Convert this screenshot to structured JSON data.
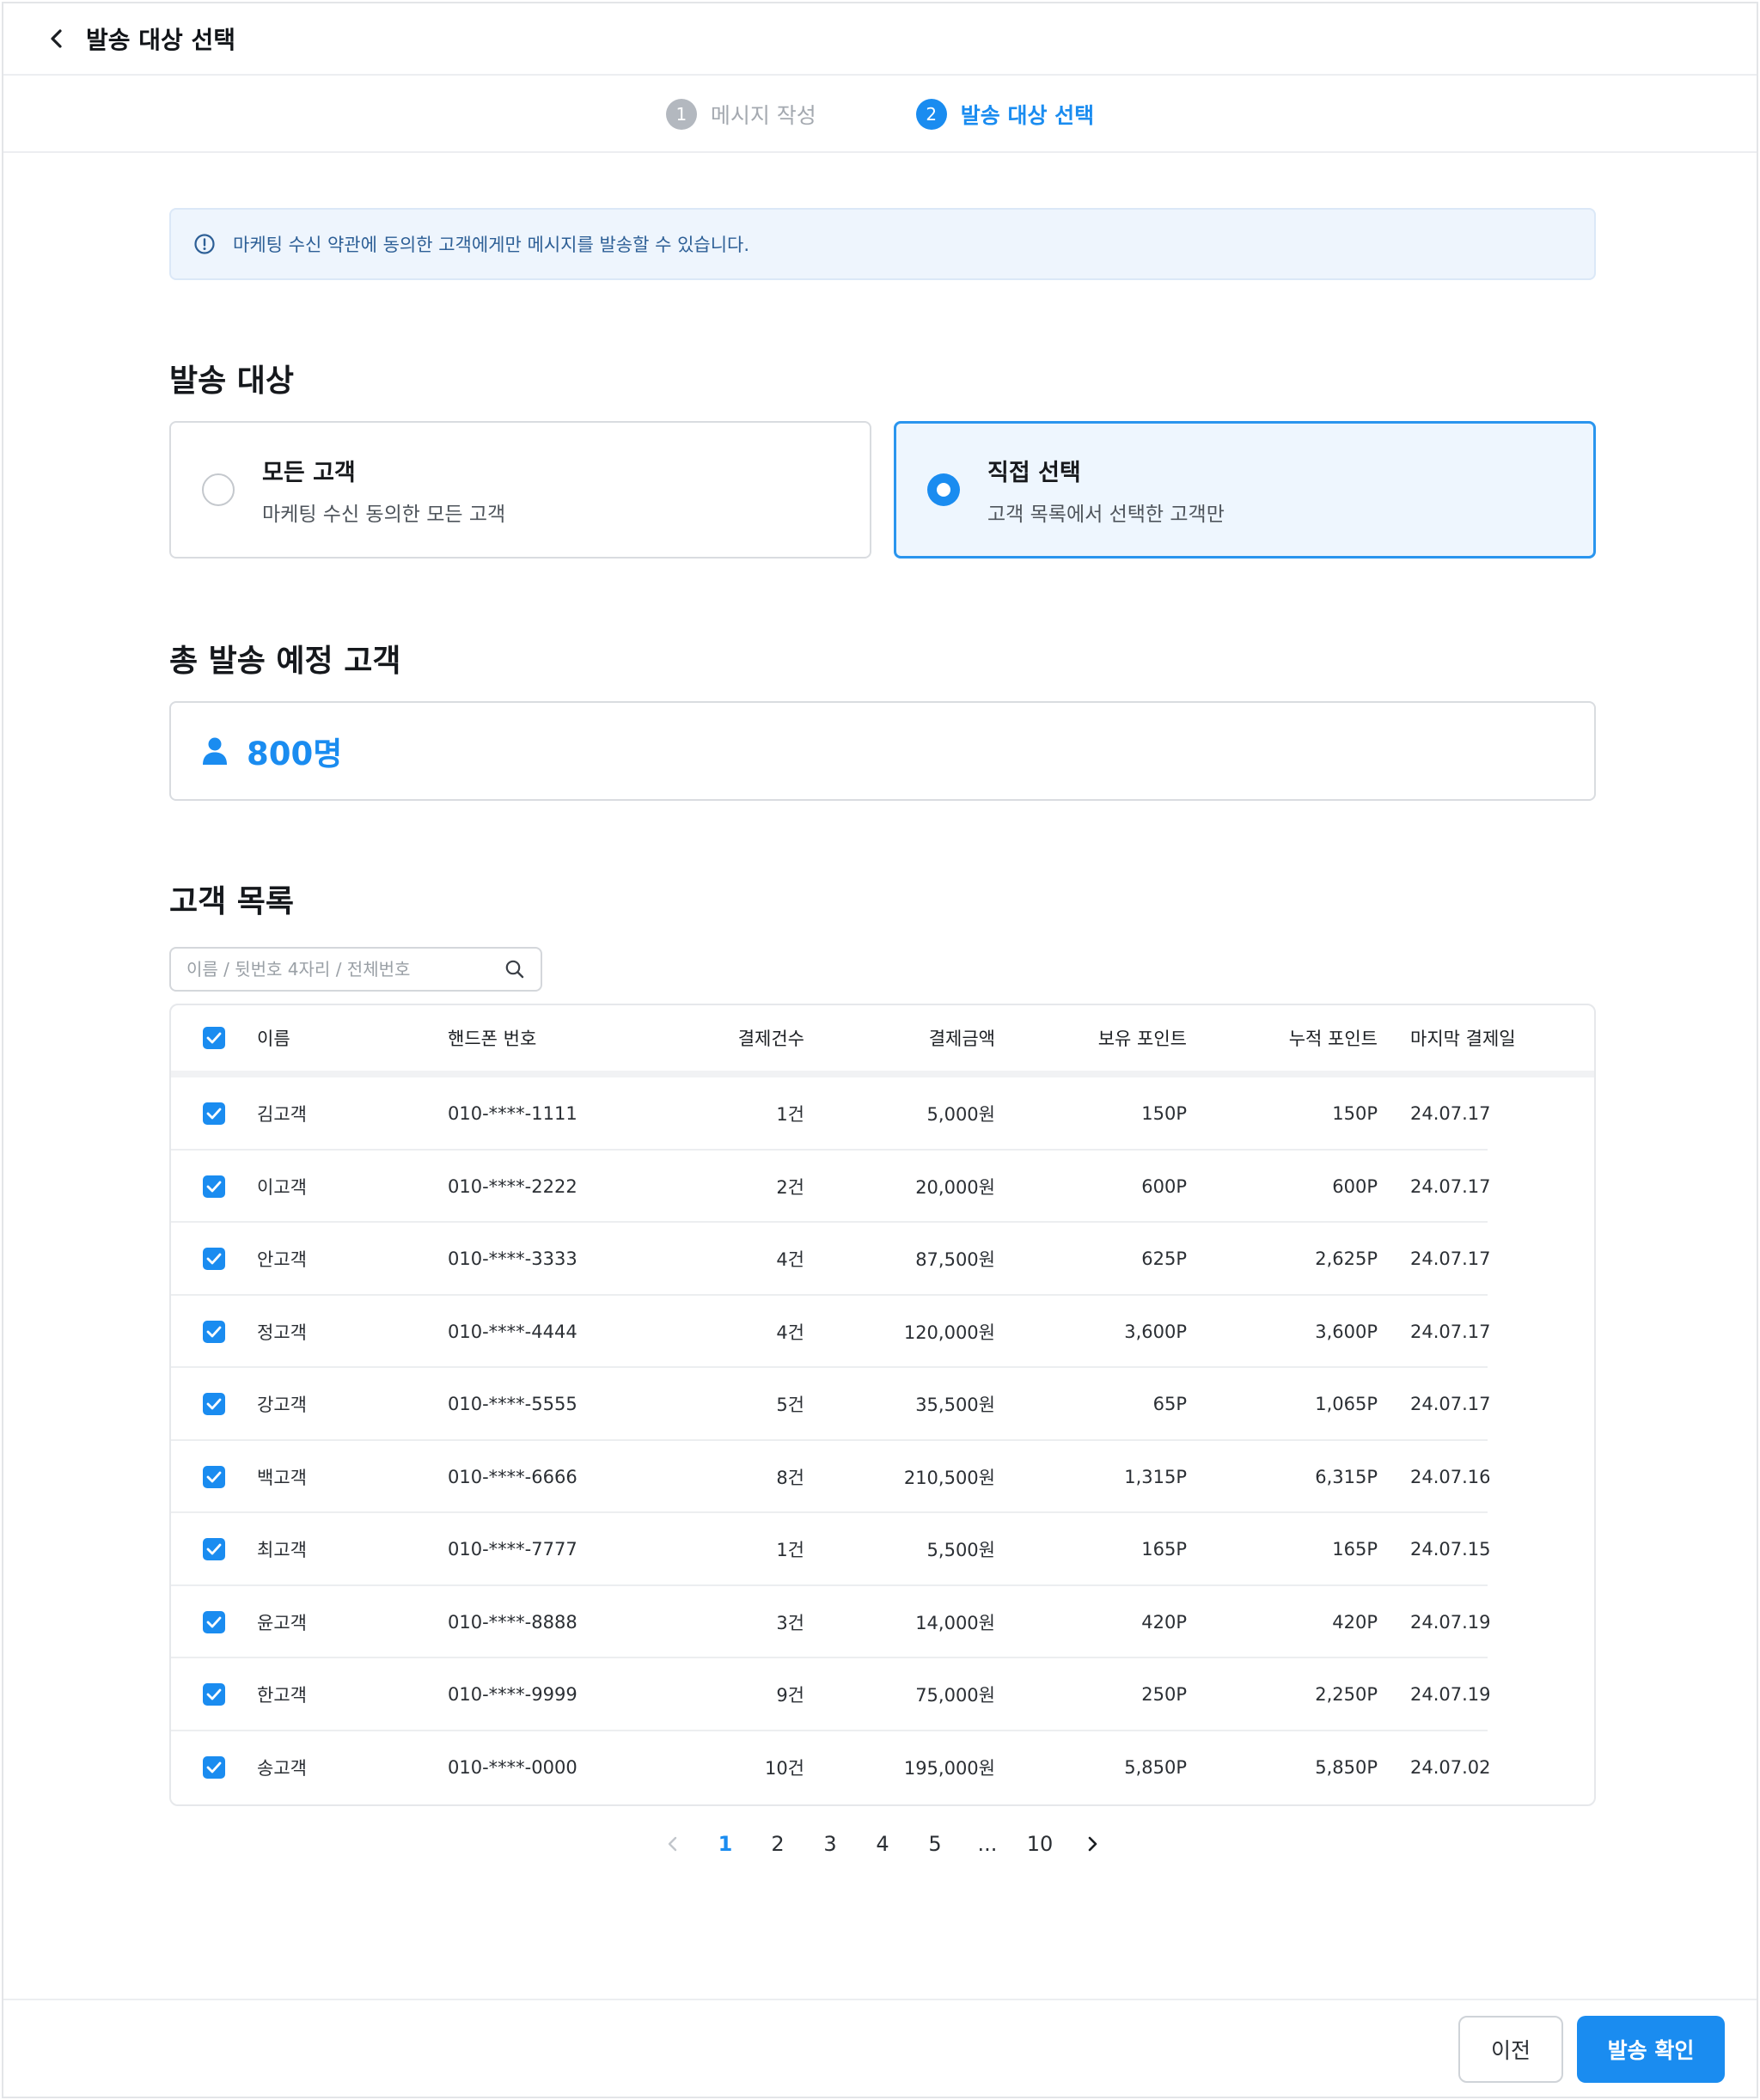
{
  "header": {
    "title": "발송 대상 선택",
    "back_icon": "chevron-left-icon"
  },
  "stepper": {
    "steps": [
      {
        "num": "1",
        "label": "메시지 작성",
        "state": "inactive"
      },
      {
        "num": "2",
        "label": "발송 대상 선택",
        "state": "active"
      }
    ]
  },
  "notice": {
    "icon": "info-circle-icon",
    "text": "마케팅 수신 약관에 동의한 고객에게만 메시지를 발송할 수 있습니다."
  },
  "target": {
    "title": "발송 대상",
    "options": [
      {
        "title": "모든 고객",
        "desc": "마케팅 수신 동의한 모든 고객",
        "selected": false
      },
      {
        "title": "직접 선택",
        "desc": "고객 목록에서 선택한 고객만",
        "selected": true
      }
    ]
  },
  "total": {
    "title": "총 발송 예정 고객",
    "value": "800명",
    "icon": "person-icon"
  },
  "customers": {
    "title": "고객 목록",
    "search_placeholder": "이름 / 뒷번호 4자리 / 전체번호",
    "columns": [
      "이름",
      "핸드폰 번호",
      "결제건수",
      "결제금액",
      "보유 포인트",
      "누적 포인트",
      "마지막 결제일"
    ],
    "rows": [
      {
        "name": "김고객",
        "phone": "010-****-1111",
        "count": "1건",
        "amount": "5,000원",
        "hold": "150P",
        "acc": "150P",
        "date": "24.07.17"
      },
      {
        "name": "이고객",
        "phone": "010-****-2222",
        "count": "2건",
        "amount": "20,000원",
        "hold": "600P",
        "acc": "600P",
        "date": "24.07.17"
      },
      {
        "name": "안고객",
        "phone": "010-****-3333",
        "count": "4건",
        "amount": "87,500원",
        "hold": "625P",
        "acc": "2,625P",
        "date": "24.07.17"
      },
      {
        "name": "정고객",
        "phone": "010-****-4444",
        "count": "4건",
        "amount": "120,000원",
        "hold": "3,600P",
        "acc": "3,600P",
        "date": "24.07.17"
      },
      {
        "name": "강고객",
        "phone": "010-****-5555",
        "count": "5건",
        "amount": "35,500원",
        "hold": "65P",
        "acc": "1,065P",
        "date": "24.07.17"
      },
      {
        "name": "백고객",
        "phone": "010-****-6666",
        "count": "8건",
        "amount": "210,500원",
        "hold": "1,315P",
        "acc": "6,315P",
        "date": "24.07.16"
      },
      {
        "name": "최고객",
        "phone": "010-****-7777",
        "count": "1건",
        "amount": "5,500원",
        "hold": "165P",
        "acc": "165P",
        "date": "24.07.15"
      },
      {
        "name": "윤고객",
        "phone": "010-****-8888",
        "count": "3건",
        "amount": "14,000원",
        "hold": "420P",
        "acc": "420P",
        "date": "24.07.19"
      },
      {
        "name": "한고객",
        "phone": "010-****-9999",
        "count": "9건",
        "amount": "75,000원",
        "hold": "250P",
        "acc": "2,250P",
        "date": "24.07.19"
      },
      {
        "name": "송고객",
        "phone": "010-****-0000",
        "count": "10건",
        "amount": "195,000원",
        "hold": "5,850P",
        "acc": "5,850P",
        "date": "24.07.02"
      }
    ]
  },
  "pagination": {
    "pages": [
      "1",
      "2",
      "3",
      "4",
      "5",
      "...",
      "10"
    ],
    "current": "1"
  },
  "footer": {
    "prev_label": "이전",
    "confirm_label": "발송 확인"
  },
  "colors": {
    "accent": "#1a8cf0",
    "notice_bg": "#eef5fd",
    "notice_text": "#2d5f96",
    "selected_card_bg": "#eef6fe"
  }
}
